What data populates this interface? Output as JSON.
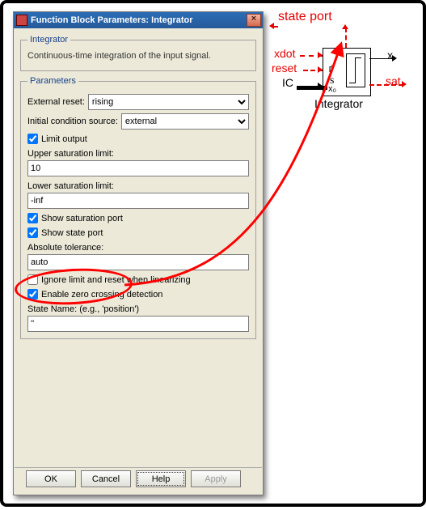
{
  "dialog": {
    "title": "Function Block Parameters: Integrator",
    "close_glyph": "×",
    "group_block": {
      "legend": "Integrator",
      "description": "Continuous-time integration of the input signal."
    },
    "group_params": {
      "legend": "Parameters",
      "external_reset": {
        "label": "External reset:",
        "value": "rising"
      },
      "initial_cond_src": {
        "label": "Initial condition source:",
        "value": "external"
      },
      "limit_output": {
        "label": "Limit output",
        "checked": true
      },
      "upper_sat": {
        "label": "Upper saturation limit:",
        "value": "10"
      },
      "lower_sat": {
        "label": "Lower saturation limit:",
        "value": "-inf"
      },
      "show_sat_port": {
        "label": "Show saturation port",
        "checked": true
      },
      "show_state_port": {
        "label": "Show state port",
        "checked": true
      },
      "abs_tol": {
        "label": "Absolute tolerance:",
        "value": "auto"
      },
      "ignore_limit": {
        "label": "Ignore limit and reset when linearizing",
        "checked": false
      },
      "zero_cross": {
        "label": "Enable zero crossing detection",
        "checked": true
      },
      "state_name": {
        "label": "State Name: (e.g., 'position')",
        "value": "''"
      }
    },
    "buttons": {
      "ok": "OK",
      "cancel": "Cancel",
      "help": "Help",
      "apply": "Apply"
    }
  },
  "diagram": {
    "state_port_label": "state port",
    "xdot": "xdot",
    "reset": "reset",
    "IC": "IC",
    "x": "x",
    "sat": "sat",
    "s": "s",
    "xo": "x₀",
    "rise": "↱",
    "block_label": "Integrator"
  }
}
